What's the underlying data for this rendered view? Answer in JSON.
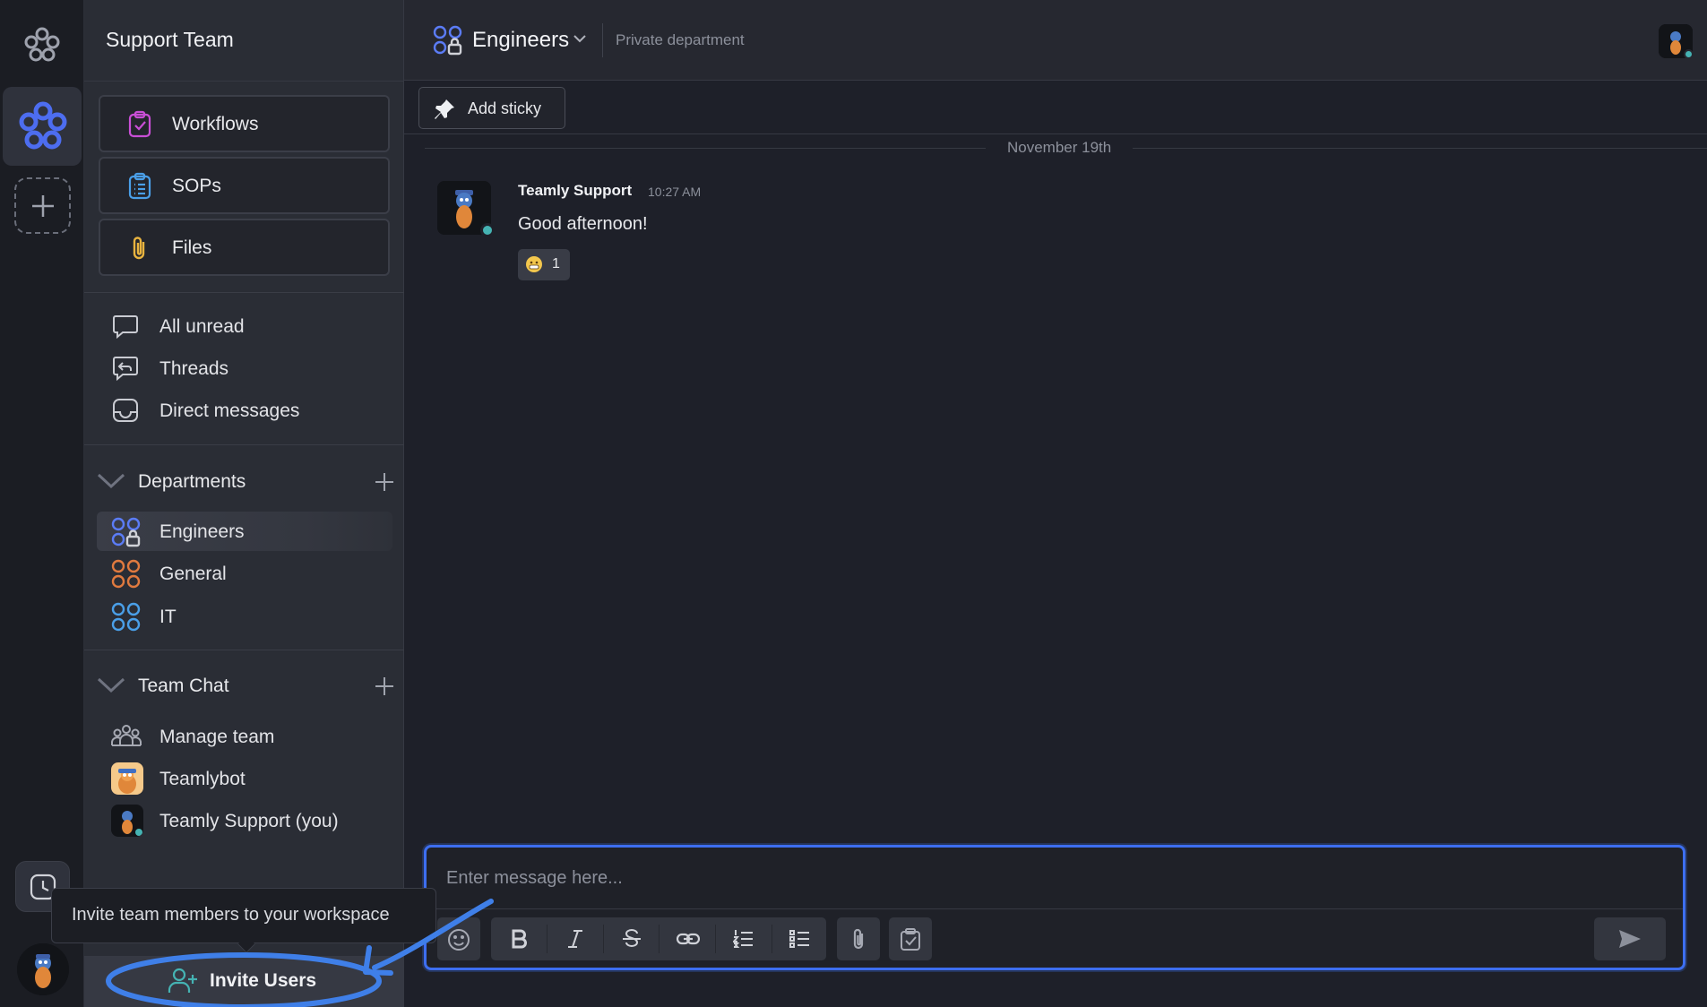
{
  "workspace": {
    "title": "Support Team"
  },
  "sidebar": {
    "tools": [
      {
        "label": "Workflows",
        "icon": "workflow-clipboard-icon"
      },
      {
        "label": "SOPs",
        "icon": "sop-list-icon"
      },
      {
        "label": "Files",
        "icon": "paperclip-icon"
      }
    ],
    "nav": [
      {
        "label": "All unread",
        "icon": "chat-bubble-icon"
      },
      {
        "label": "Threads",
        "icon": "threads-reply-icon"
      },
      {
        "label": "Direct messages",
        "icon": "inbox-icon"
      }
    ],
    "departments": {
      "label": "Departments",
      "items": [
        {
          "label": "Engineers",
          "color": "#5b7cf6",
          "private": true
        },
        {
          "label": "General",
          "color": "#e07a3f"
        },
        {
          "label": "IT",
          "color": "#4a9fe8"
        }
      ]
    },
    "team_chat": {
      "label": "Team Chat",
      "items": [
        {
          "label": "Manage team"
        },
        {
          "label": "Teamlybot"
        },
        {
          "label": "Teamly Support (you)"
        }
      ]
    },
    "invite": {
      "label": "Invite Users",
      "tooltip": "Invite team members to your workspace"
    }
  },
  "channel": {
    "name": "Engineers",
    "visibility": "Private department",
    "sticky_label": "Add sticky",
    "date_divider": "November 19th"
  },
  "messages": [
    {
      "author": "Teamly Support",
      "time": "10:27 AM",
      "text": "Good afternoon!",
      "reactions": [
        {
          "emoji": "grimace",
          "count": "1"
        }
      ]
    }
  ],
  "composer": {
    "placeholder": "Enter message here..."
  },
  "colors": {
    "accent": "#3d6ef0",
    "online": "#45b3b3",
    "workflow_icon": "#c94fd6",
    "sop_icon": "#4a9fe8",
    "files_icon": "#e8b33f"
  }
}
